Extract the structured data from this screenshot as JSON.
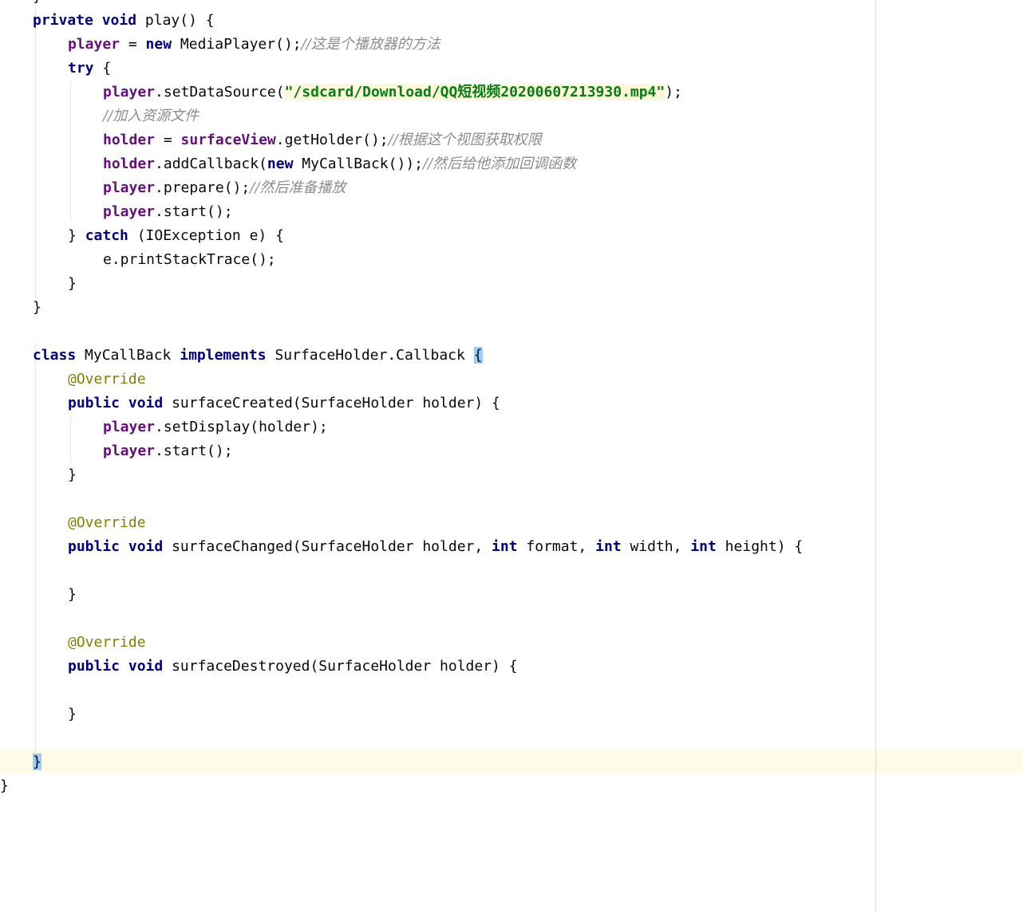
{
  "editor": {
    "lines": [
      {
        "tokens": [
          {
            "t": "}",
            "c": "pl"
          }
        ]
      },
      {
        "tokens": [
          {
            "t": "private",
            "c": "kw"
          },
          {
            "t": " ",
            "c": "pl"
          },
          {
            "t": "void",
            "c": "kw"
          },
          {
            "t": " play() {",
            "c": "pl"
          }
        ]
      },
      {
        "tokens": [
          {
            "t": "player",
            "c": "fld"
          },
          {
            "t": " = ",
            "c": "pl"
          },
          {
            "t": "new",
            "c": "kw"
          },
          {
            "t": " MediaPlayer();",
            "c": "pl"
          },
          {
            "t": "//这是个播放器的方法",
            "c": "cmt"
          }
        ]
      },
      {
        "tokens": [
          {
            "t": "try",
            "c": "kw"
          },
          {
            "t": " {",
            "c": "pl"
          }
        ]
      },
      {
        "tokens": [
          {
            "t": "player",
            "c": "fld"
          },
          {
            "t": ".setDataSource(",
            "c": "pl"
          },
          {
            "t": "\"/sdcard/Download/QQ短视频20200607213930.mp4\"",
            "c": "str"
          },
          {
            "t": ");",
            "c": "pl"
          }
        ]
      },
      {
        "tokens": [
          {
            "t": "//加入资源文件",
            "c": "cmt"
          }
        ]
      },
      {
        "tokens": [
          {
            "t": "holder",
            "c": "fld"
          },
          {
            "t": " = ",
            "c": "pl"
          },
          {
            "t": "surfaceView",
            "c": "fld"
          },
          {
            "t": ".getHolder();",
            "c": "pl"
          },
          {
            "t": "//根据这个视图获取权限",
            "c": "cmt"
          }
        ]
      },
      {
        "tokens": [
          {
            "t": "holder",
            "c": "fld"
          },
          {
            "t": ".addCallback(",
            "c": "pl"
          },
          {
            "t": "new",
            "c": "kw"
          },
          {
            "t": " MyCallBack());",
            "c": "pl"
          },
          {
            "t": "//然后给他添加回调函数",
            "c": "cmt"
          }
        ]
      },
      {
        "tokens": [
          {
            "t": "player",
            "c": "fld"
          },
          {
            "t": ".prepare();",
            "c": "pl"
          },
          {
            "t": "//然后准备播放",
            "c": "cmt"
          }
        ]
      },
      {
        "tokens": [
          {
            "t": "player",
            "c": "fld"
          },
          {
            "t": ".start();",
            "c": "pl"
          }
        ]
      },
      {
        "tokens": [
          {
            "t": "} ",
            "c": "pl"
          },
          {
            "t": "catch",
            "c": "kw"
          },
          {
            "t": " (IOException e) {",
            "c": "pl"
          }
        ]
      },
      {
        "tokens": [
          {
            "t": "e.printStackTrace();",
            "c": "pl"
          }
        ]
      },
      {
        "tokens": [
          {
            "t": "}",
            "c": "pl"
          }
        ]
      },
      {
        "tokens": [
          {
            "t": "}",
            "c": "pl"
          }
        ]
      },
      {
        "tokens": []
      },
      {
        "tokens": [
          {
            "t": "class",
            "c": "kw"
          },
          {
            "t": " MyCallBack ",
            "c": "pl"
          },
          {
            "t": "implements",
            "c": "kw"
          },
          {
            "t": " SurfaceHolder.Callback ",
            "c": "pl"
          },
          {
            "t": "{",
            "c": "brace-hl"
          }
        ]
      },
      {
        "tokens": [
          {
            "t": "@Override",
            "c": "ann"
          }
        ]
      },
      {
        "tokens": [
          {
            "t": "public",
            "c": "kw"
          },
          {
            "t": " ",
            "c": "pl"
          },
          {
            "t": "void",
            "c": "kw"
          },
          {
            "t": " surfaceCreated(SurfaceHolder holder) {",
            "c": "pl"
          }
        ]
      },
      {
        "tokens": [
          {
            "t": "player",
            "c": "fld"
          },
          {
            "t": ".setDisplay(holder);",
            "c": "pl"
          }
        ]
      },
      {
        "tokens": [
          {
            "t": "player",
            "c": "fld"
          },
          {
            "t": ".start();",
            "c": "pl"
          }
        ]
      },
      {
        "tokens": [
          {
            "t": "}",
            "c": "pl"
          }
        ]
      },
      {
        "tokens": []
      },
      {
        "tokens": [
          {
            "t": "@Override",
            "c": "ann"
          }
        ]
      },
      {
        "tokens": [
          {
            "t": "public",
            "c": "kw"
          },
          {
            "t": " ",
            "c": "pl"
          },
          {
            "t": "void",
            "c": "kw"
          },
          {
            "t": " surfaceChanged(SurfaceHolder holder, ",
            "c": "pl"
          },
          {
            "t": "int",
            "c": "kw"
          },
          {
            "t": " format, ",
            "c": "pl"
          },
          {
            "t": "int",
            "c": "kw"
          },
          {
            "t": " width, ",
            "c": "pl"
          },
          {
            "t": "int",
            "c": "kw"
          },
          {
            "t": " height) {",
            "c": "pl"
          }
        ]
      },
      {
        "tokens": []
      },
      {
        "tokens": [
          {
            "t": "}",
            "c": "pl"
          }
        ]
      },
      {
        "tokens": []
      },
      {
        "tokens": [
          {
            "t": "@Override",
            "c": "ann"
          }
        ]
      },
      {
        "tokens": [
          {
            "t": "public",
            "c": "kw"
          },
          {
            "t": " ",
            "c": "pl"
          },
          {
            "t": "void",
            "c": "kw"
          },
          {
            "t": " surfaceDestroyed(SurfaceHolder holder) {",
            "c": "pl"
          }
        ]
      },
      {
        "tokens": []
      },
      {
        "tokens": [
          {
            "t": "}",
            "c": "pl"
          }
        ]
      },
      {
        "tokens": []
      },
      {
        "tokens": [
          {
            "t": "}",
            "c": "brace-hl"
          }
        ]
      },
      {
        "tokens": [
          {
            "t": "}",
            "c": "pl"
          }
        ]
      }
    ]
  }
}
